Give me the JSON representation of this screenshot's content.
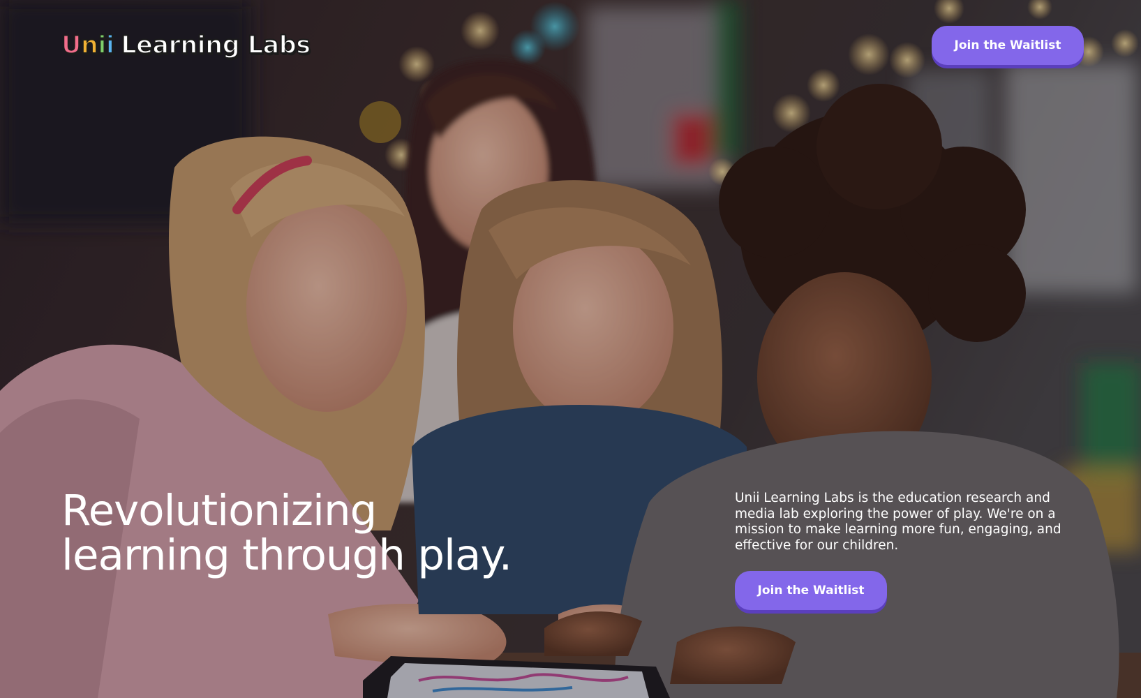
{
  "header": {
    "logo": {
      "text": "Unii Learning Labs",
      "letters": [
        {
          "char": "U",
          "color": "#f26d8b"
        },
        {
          "char": "n",
          "color": "#f2b134"
        },
        {
          "char": "i",
          "color": "#7fcf6a"
        },
        {
          "char": "i",
          "color": "#5ab3f0"
        }
      ],
      "rest": "Learning Labs"
    },
    "cta_label": "Join the Waitlist"
  },
  "hero": {
    "headline_line1": "Revolutionizing",
    "headline_line2": "learning through play.",
    "description": "Unii Learning Labs is the education research and media lab exploring the power of play. We're on a mission to make learning more fun, engaging, and effective for our children.",
    "cta_label": "Join the Waitlist",
    "background_image": "photo-children-learning-with-tablet"
  },
  "colors": {
    "accent": "#8367ea",
    "accent_shadow": "#5b3fbd",
    "text": "#ffffff"
  }
}
